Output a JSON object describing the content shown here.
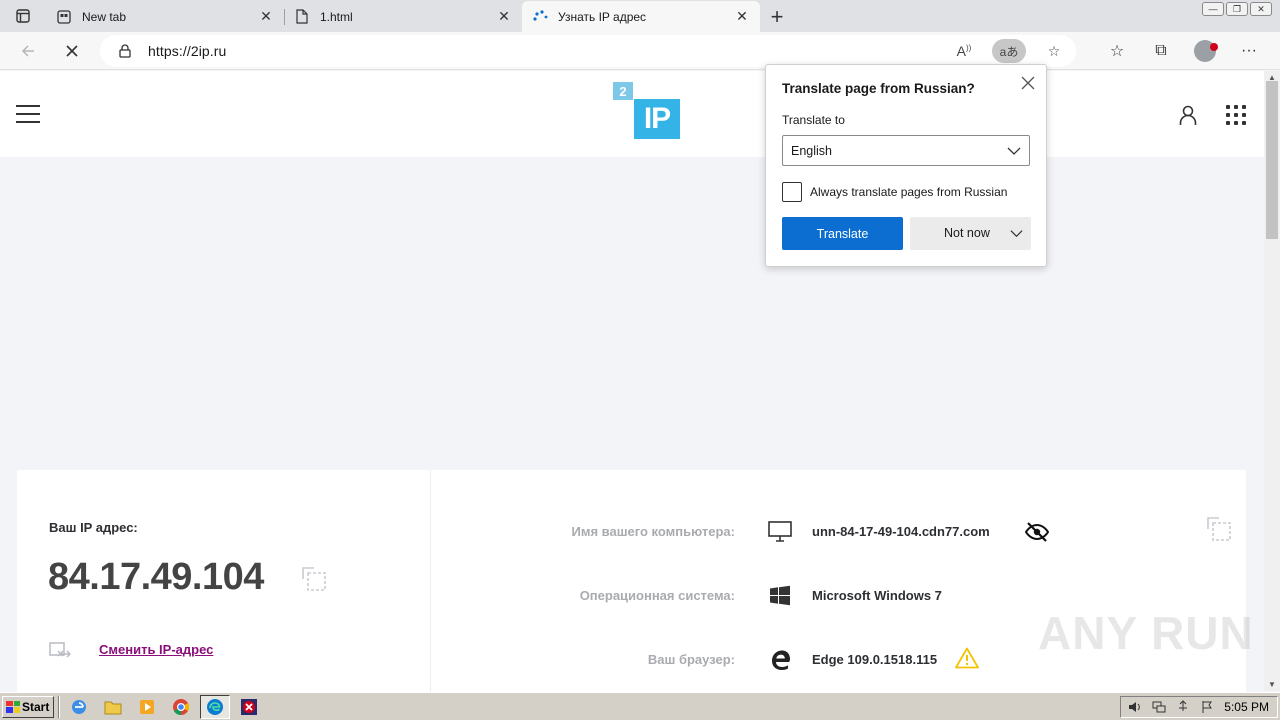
{
  "browser": {
    "tabs": [
      {
        "label": "New tab",
        "icon": "new-tab-page-icon",
        "active": false
      },
      {
        "label": "1.html",
        "icon": "file-icon",
        "active": false
      },
      {
        "label": "Узнать IP адрес",
        "icon": "loading-spinner-icon",
        "active": true
      }
    ],
    "address": {
      "url": "https://2ip.ru"
    }
  },
  "site": {
    "logo": {
      "small": "2",
      "big": "IP"
    },
    "ip_label": "Ваш IP адрес:",
    "ip_value": "84.17.49.104",
    "change_ip_link": "Сменить IP-адрес",
    "info": [
      {
        "label": "Имя вашего компьютера:",
        "value": "unn-84-17-49-104.cdn77.com",
        "icon": "monitor-icon"
      },
      {
        "label": "Операционная система:",
        "value": "Microsoft Windows 7",
        "icon": "windows-logo-icon"
      },
      {
        "label": "Ваш браузер:",
        "value": "Edge 109.0.1518.115",
        "icon": "edge-logo-icon"
      }
    ]
  },
  "translate_popup": {
    "title": "Translate page from Russian?",
    "translate_to_label": "Translate to",
    "selected_language": "English",
    "always_translate_label": "Always translate pages from Russian",
    "always_translate_checked": false,
    "translate_button": "Translate",
    "not_now_button": "Not now"
  },
  "watermark": "ANY RUN",
  "taskbar": {
    "start_label": "Start",
    "clock": "5:05 PM"
  },
  "colors": {
    "accent_blue": "#0b6ed0",
    "logo_blue": "#33b3e6",
    "link_purple": "#8a0f7b",
    "warning_yellow": "#f2c300"
  }
}
